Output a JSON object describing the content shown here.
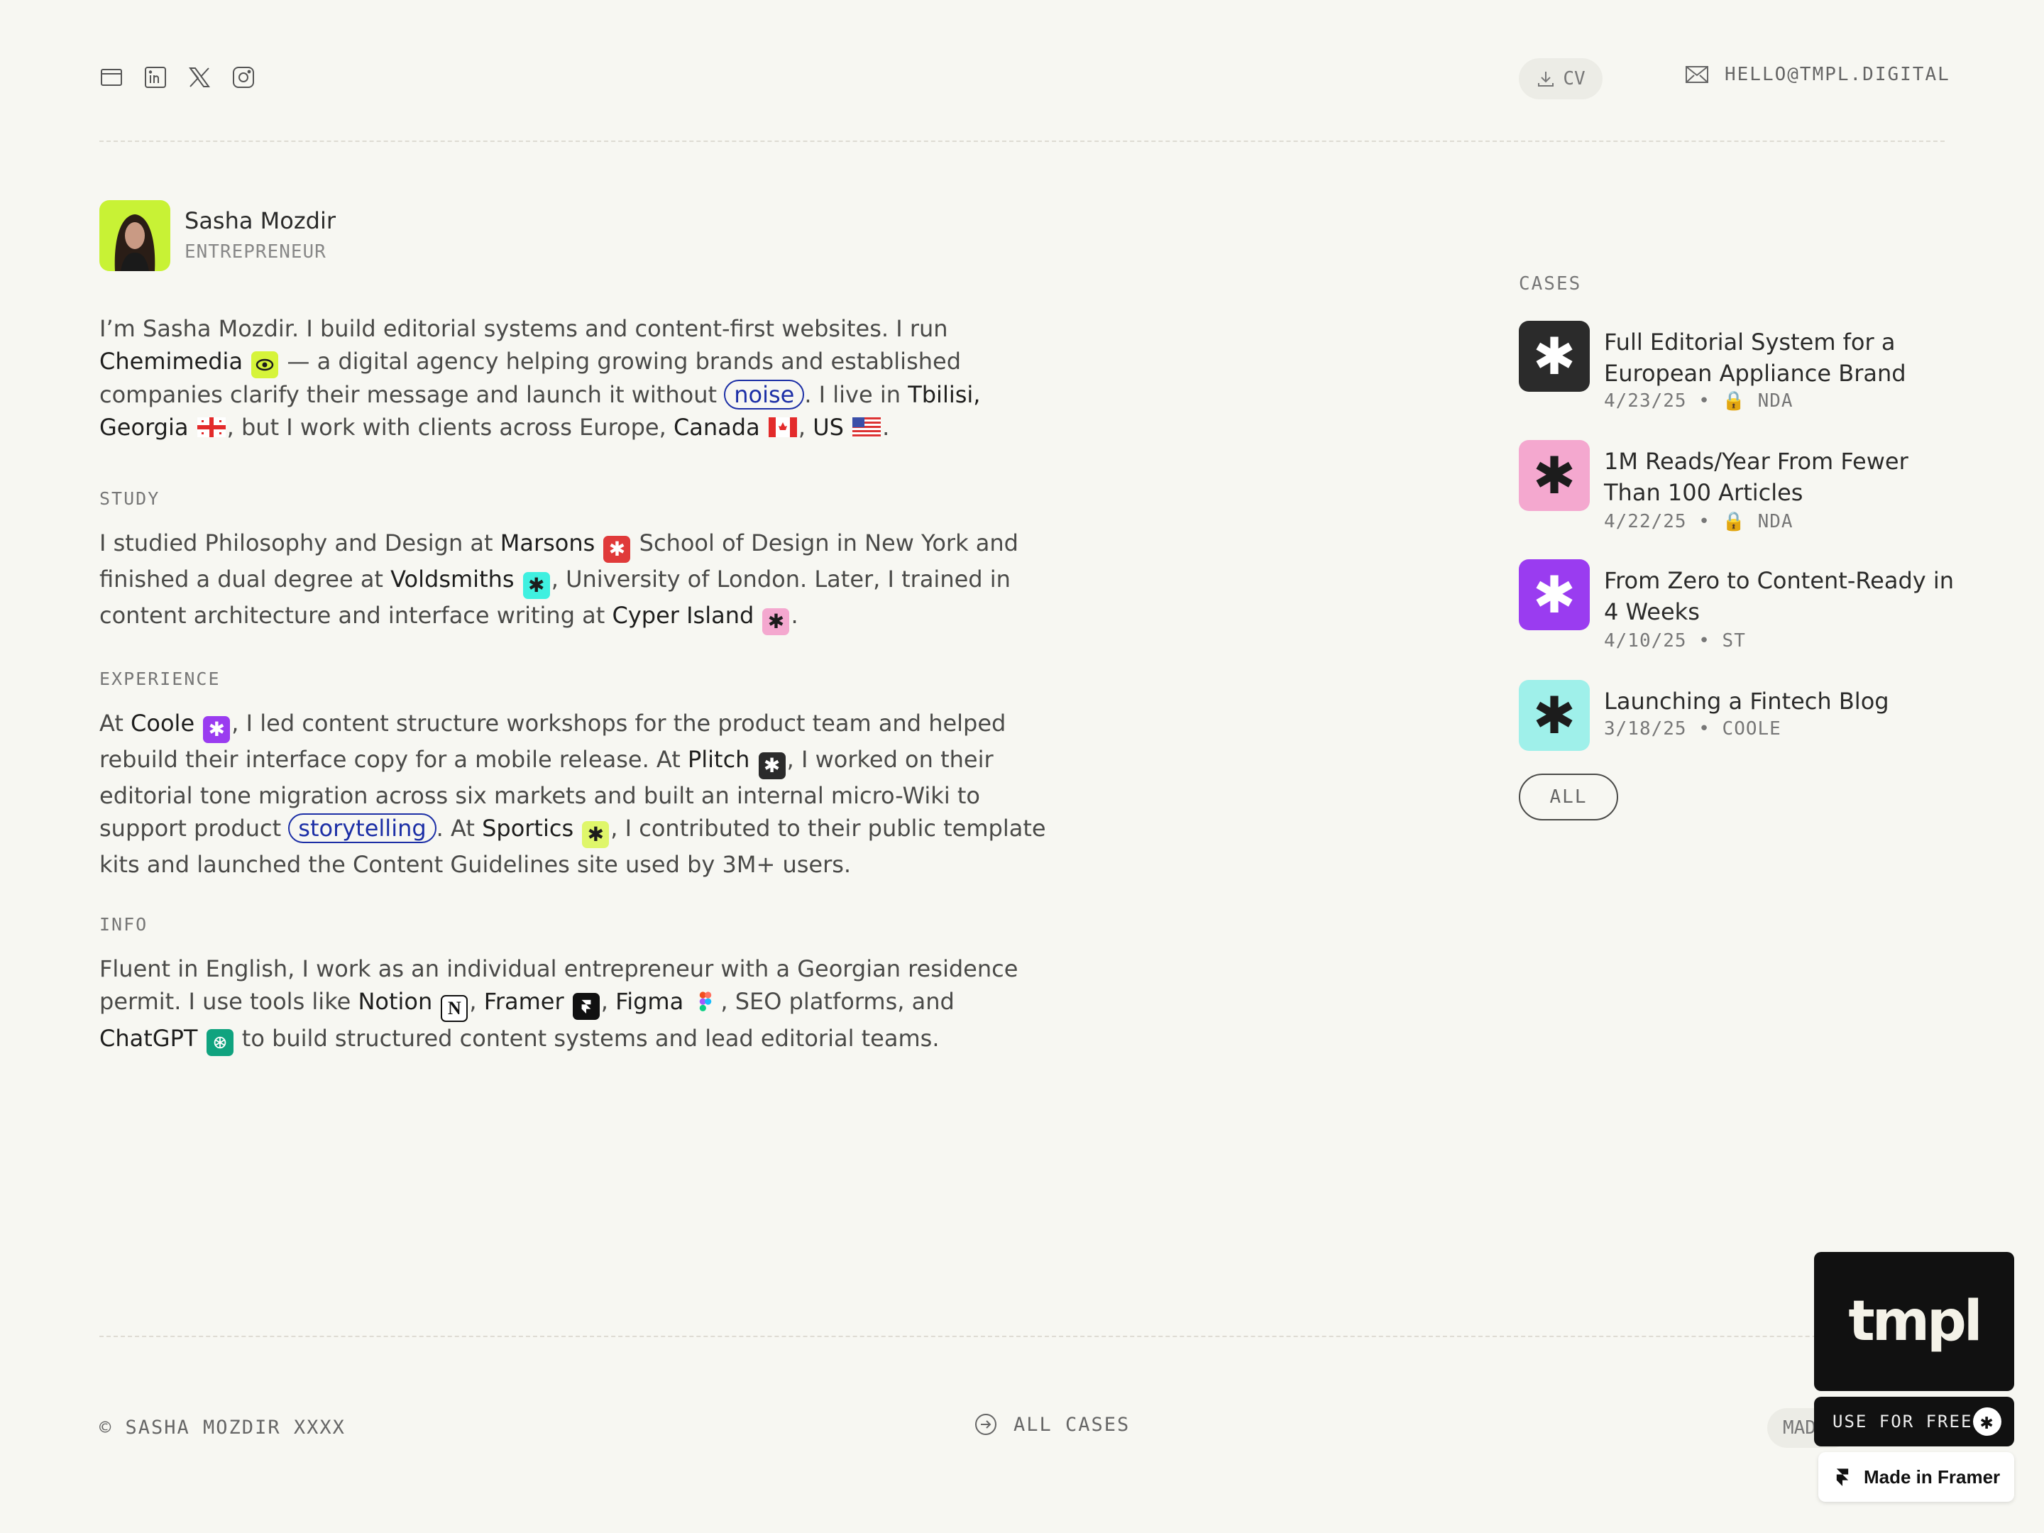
{
  "header": {
    "social_icons": [
      "window-icon",
      "linkedin-icon",
      "x-icon",
      "instagram-icon"
    ],
    "cv_label": "CV",
    "email": "HELLO@TMPL.DIGITAL"
  },
  "profile": {
    "name": "Sasha Mozdir",
    "role": "ENTREPRENEUR"
  },
  "bio": {
    "t1": "I’m Sasha Mozdir. I build editorial systems and content-first websites. I run ",
    "chemimedia": "Chemimedia",
    "t2": " — a digital agency helping growing brands and established companies clarify their message and launch it without ",
    "noise": "noise",
    "t3": ". I live in ",
    "tbilisi": "Tbilisi, Georgia",
    "t4": ", but I work with clients across Europe, ",
    "canada": "Canada",
    "t5": ", ",
    "us": "US",
    "t6": "."
  },
  "study": {
    "title": "STUDY",
    "t1": "I studied Philosophy and Design at ",
    "marsons": "Marsons",
    "t2": " School of Design in New York and finished a dual degree at ",
    "voldsmiths": "Voldsmiths",
    "t3": ", University of London. Later, I trained in content architecture and interface writing at ",
    "cyper": "Cyper Island",
    "t4": "."
  },
  "experience": {
    "title": "EXPERIENCE",
    "t1": "At ",
    "coole": "Coole",
    "t2": ", I led content structure workshops for the product team and helped rebuild their interface copy for a mobile release. At ",
    "plitch": "Plitch",
    "t3": ", I worked on their editorial tone migration across six markets and built an internal micro-Wiki to support product ",
    "storytelling": "storytelling",
    "t4": ". At ",
    "sportics": "Sportics",
    "t5": ", I contributed to their public template kits and launched the Content Guidelines site used by 3M+ users."
  },
  "info": {
    "title": "INFO",
    "t1": "Fluent in English, I work as an individual entrepreneur with a Georgian residence permit. I use tools like ",
    "notion": "Notion",
    "t2": ", ",
    "framer": "Framer",
    "t3": ", ",
    "figma": "Figma",
    "t4": ", SEO platforms, and ",
    "chatgpt": "ChatGPT",
    "t5": " to build structured content systems and lead editorial teams."
  },
  "cases": {
    "title": "CASES",
    "items": [
      {
        "title": "Full Editorial System for a European Appliance Brand",
        "date": "4/23/25",
        "tag": "NDA",
        "locked": true,
        "color": "#2b2b2b"
      },
      {
        "title": "1M Reads/Year From Fewer Than 100 Articles",
        "date": "4/22/25",
        "tag": "NDA",
        "locked": true,
        "color": "#f4a8cf"
      },
      {
        "title": "From Zero to Content-Ready in 4 Weeks",
        "date": "4/10/25",
        "tag": "ST",
        "locked": false,
        "color": "#9a3cf0"
      },
      {
        "title": "Launching a Fintech Blog",
        "date": "3/18/25",
        "tag": "COOLE",
        "locked": false,
        "color": "#9ff0ea"
      }
    ],
    "all_label": "ALL"
  },
  "footer": {
    "copyright": "© SASHA MOZDIR XXXX",
    "all_cases": "ALL CASES",
    "made_by": "MADE BY"
  },
  "badge": {
    "logo": "tmpl",
    "use_free": "USE FOR FREE",
    "made_in_framer": "Made in Framer"
  }
}
